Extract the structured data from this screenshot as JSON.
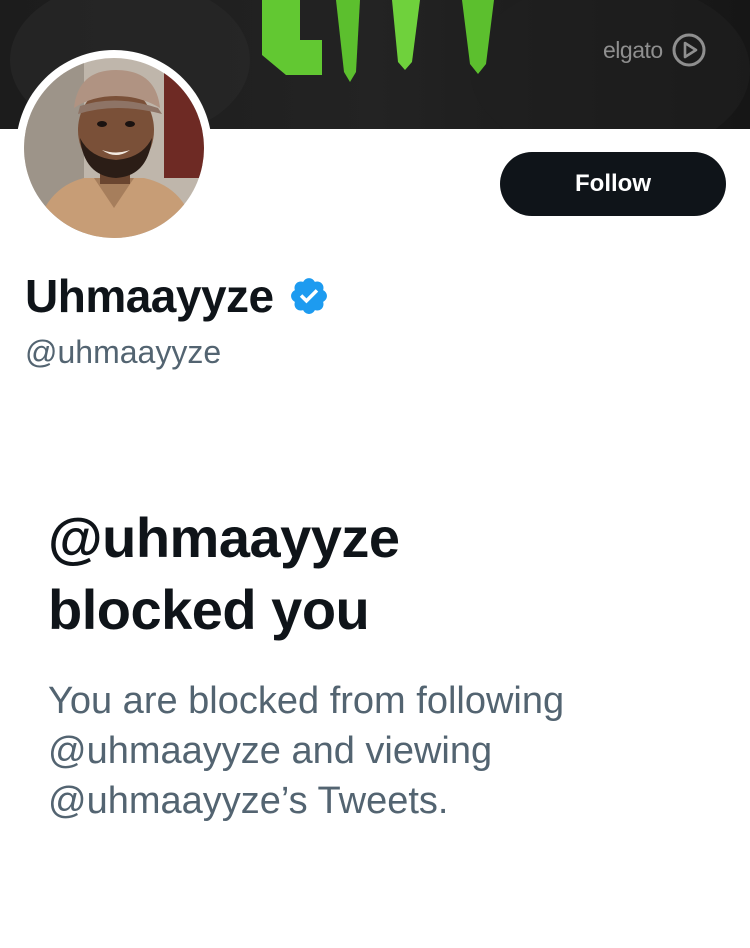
{
  "banner": {
    "brand_text": "elgato",
    "brand_icon": "elgato-logo-icon"
  },
  "profile": {
    "avatar_icon": "profile-avatar",
    "follow_label": "Follow",
    "display_name": "Uhmaayyze",
    "verified_icon": "verified-badge-icon",
    "handle": "@uhmaayyze"
  },
  "blocked": {
    "title_line1": "@uhmaayyze",
    "title_line2": "blocked you",
    "desc_line1": "You are blocked from following",
    "desc_line2": "@uhmaayyze and viewing",
    "desc_line3": "@uhmaayyze’s Tweets."
  },
  "colors": {
    "accent_green": "#6fd13c",
    "verified_blue": "#1d9bf0",
    "button_dark": "#0f1419",
    "secondary_text": "#536471"
  }
}
